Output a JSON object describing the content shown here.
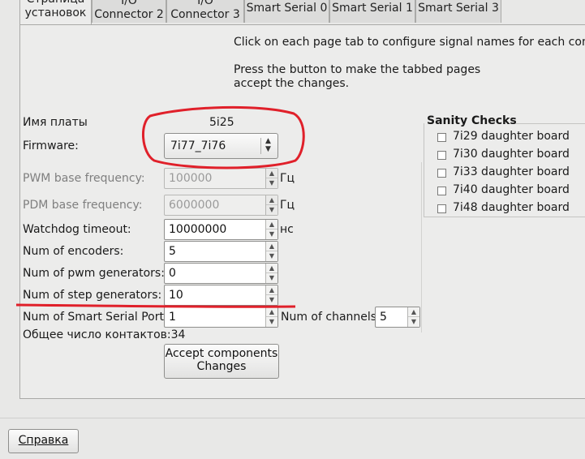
{
  "tabs": [
    {
      "line1": "Страница",
      "line2": "установок",
      "active": true
    },
    {
      "line1": "I/O",
      "line2": "Connector 2"
    },
    {
      "line1": "I/O",
      "line2": "Connector 3"
    },
    {
      "line1": "Smart Serial 0"
    },
    {
      "line1": "Smart Serial 1"
    },
    {
      "line1": "Smart Serial 3"
    }
  ],
  "info": {
    "line1": "Click on each page tab to configure signal names for each connect",
    "line2": "Press the button to make the tabbed pages",
    "line3": "accept the changes."
  },
  "board": {
    "label": "Имя платы",
    "value": "5i25"
  },
  "firmware": {
    "label": "Firmware:",
    "value": "7i77_7i76"
  },
  "fields": {
    "pwm": {
      "label": "PWM base frequency:",
      "value": "100000",
      "unit": "Гц"
    },
    "pdm": {
      "label": "PDM base frequency:",
      "value": "6000000",
      "unit": "Гц"
    },
    "watchdog": {
      "label": "Watchdog timeout:",
      "value": "10000000",
      "unit": "нс"
    },
    "encoders": {
      "label": "Num of encoders:",
      "value": "5"
    },
    "pwmgens": {
      "label": "Num of pwm generators:",
      "value": "0"
    },
    "stepgens": {
      "label": "Num of step generators:",
      "value": "10"
    },
    "sserial": {
      "label": "Num of Smart Serial Ports:",
      "value": "1"
    },
    "channels": {
      "label": "Num of channels:",
      "value": "5"
    }
  },
  "total_pins": {
    "label": "Общее число контактов:",
    "value": "34"
  },
  "accept_button": {
    "line1": "Accept  components",
    "line2": "Changes"
  },
  "sanity": {
    "title": "Sanity Checks",
    "items": [
      "7i29 daughter board",
      "7i30 daughter board",
      "7i33 daughter board",
      "7i40 daughter board",
      "7i48 daughter board"
    ]
  },
  "help_button": "Справка",
  "annotation_color": "#e0202a"
}
